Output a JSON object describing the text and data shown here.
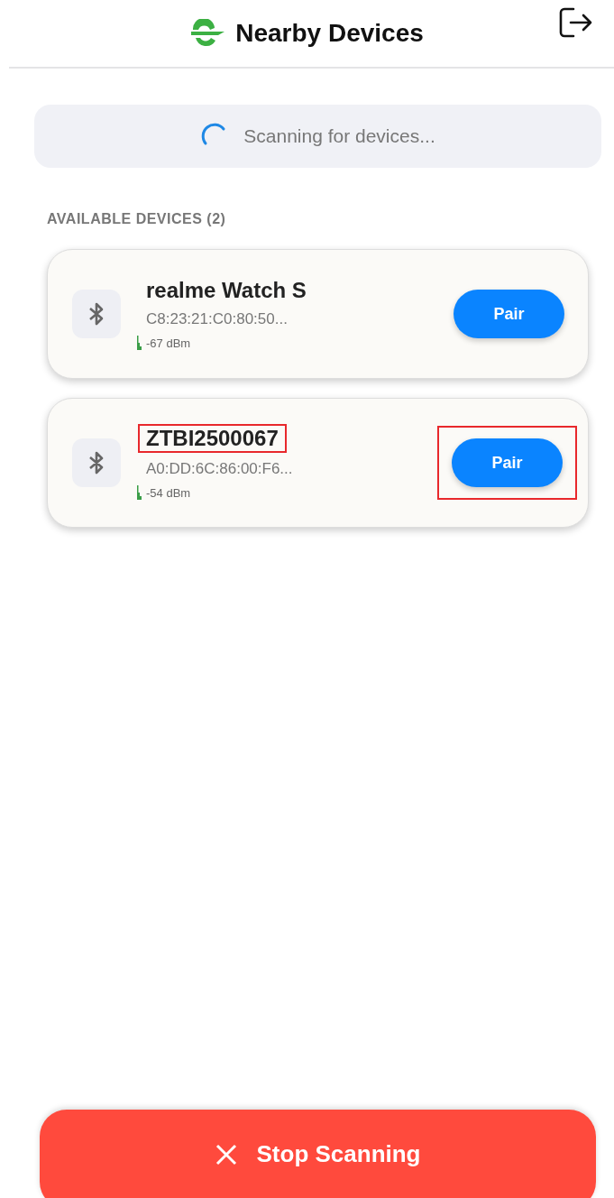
{
  "header": {
    "title": "Nearby Devices"
  },
  "scan_status": {
    "text": "Scanning for devices...",
    "scanning": true
  },
  "section_label": "AVAILABLE DEVICES (2)",
  "devices": [
    {
      "name": "realme Watch S",
      "address": "C8:23:21:C0:80:50...",
      "signal": "-67 dBm",
      "button": "Pair",
      "name_highlighted": false,
      "button_highlighted": false
    },
    {
      "name": "ZTBI2500067",
      "address": "A0:DD:6C:86:00:F6...",
      "signal": "-54 dBm",
      "button": "Pair",
      "name_highlighted": true,
      "button_highlighted": true
    }
  ],
  "stop_button": {
    "label": "Stop Scanning"
  }
}
